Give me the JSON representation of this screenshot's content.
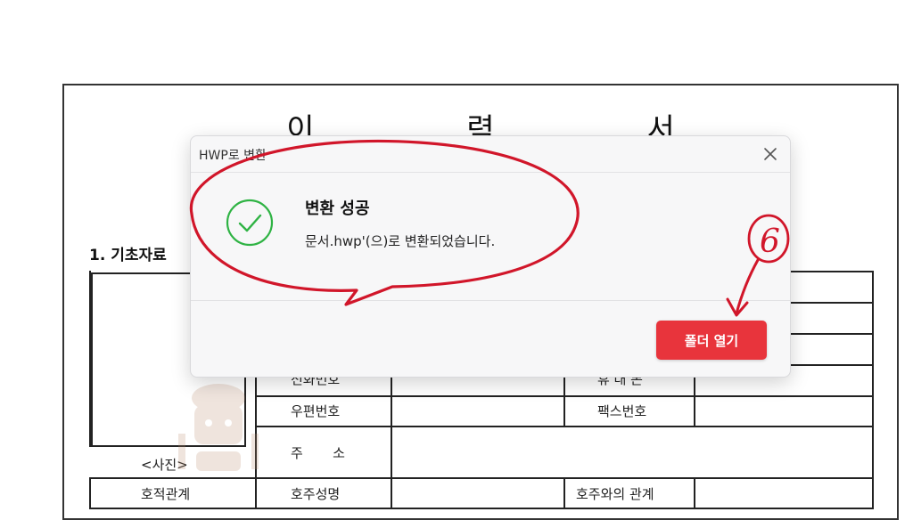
{
  "document": {
    "title": "이 력 서",
    "section_heading": "1. 기초자료",
    "photo_label": "<사진>",
    "table": {
      "phone_label": "전화번호",
      "mobile_label": "휴 대 폰",
      "postal_code_label": "우편번호",
      "fax_label": "팩스번호",
      "address_label": "주       소",
      "family_relation_label": "호적관계",
      "head_name_label": "호주성명",
      "relation_to_head_label": "호주와의 관계"
    }
  },
  "dialog": {
    "title": "HWP로 변환",
    "success_heading": "변환 성공",
    "success_message": "문서.hwp'(으)로 변환되었습니다.",
    "open_folder_label": "폴더 열기",
    "accent_color": "#e8343c",
    "success_color": "#2fb344"
  },
  "annotation": {
    "step_number": "6",
    "ink_color": "#d1162a"
  },
  "icons": {
    "close": "close-icon",
    "success": "check-circle-icon"
  }
}
